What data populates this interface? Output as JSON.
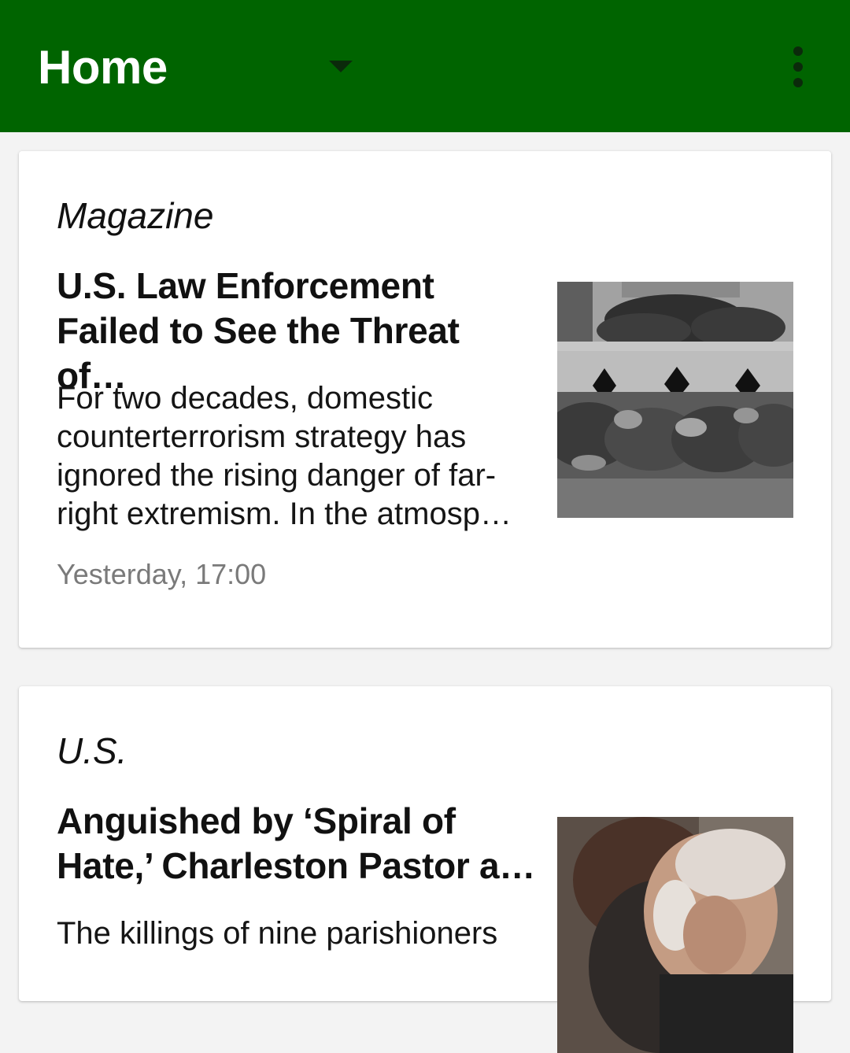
{
  "appbar": {
    "title": "Home",
    "background": "#006400",
    "dropdown_icon": "arrow-drop-down-icon",
    "overflow_icon": "more-vert-icon"
  },
  "articles": [
    {
      "section": "Magazine",
      "headline_line1": "U.S. Law Enforcement",
      "headline_line2": "Failed to See the Threat of…",
      "summary_lines": [
        "For two decades, domestic",
        "counterterrorism strategy has",
        "ignored the rising danger of far-",
        "right extremism. In the atmosp…"
      ],
      "time": "Yesterday, 17:00",
      "image": "memorial-flowers-photo"
    },
    {
      "section": "U.S.",
      "headline_line1": "Anguished by ‘Spiral of",
      "headline_line2": "Hate,’ Charleston Pastor a…",
      "summary_lines": [
        "The killings of nine parishioners"
      ],
      "image": "embrace-photo"
    }
  ]
}
